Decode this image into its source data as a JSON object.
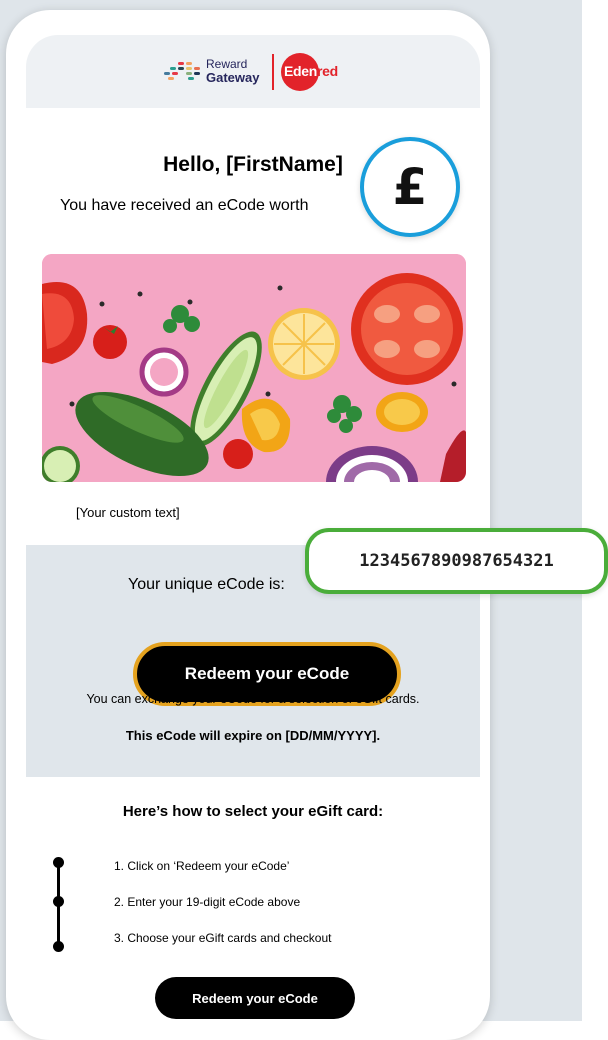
{
  "header": {
    "reward_gateway_line1": "Reward",
    "reward_gateway_line2": "Gateway",
    "edenred_brand": "Eden",
    "edenred_tail": "red"
  },
  "email": {
    "greeting": "Hello, [FirstName]",
    "subline": "You have received an eCode worth",
    "currency_symbol": "£",
    "custom_text": "[Your custom text]",
    "code_label": "Your unique eCode is:",
    "code_value": "1234567890987654321",
    "redeem_button": "Redeem your eCode",
    "exchange_text": "You can exchange your eCode for a selection of eGift cards.",
    "expire_text": "This eCode will expire on [DD/MM/YYYY].",
    "howto_title": "Here’s how to select your eGift card:",
    "steps": [
      "1. Click on ‘Redeem your eCode’",
      "2. Enter your 19-digit eCode above",
      "3. Choose your eGift cards and checkout"
    ],
    "redeem_button_bottom": "Redeem your eCode"
  },
  "colors": {
    "page_bg": "#dfe5ea",
    "edenred_red": "#e2232a",
    "badge_blue": "#1a9edb",
    "code_green": "#4aad3a",
    "button_gold": "#e4a21f",
    "hero_pink": "#f4a6c4"
  }
}
